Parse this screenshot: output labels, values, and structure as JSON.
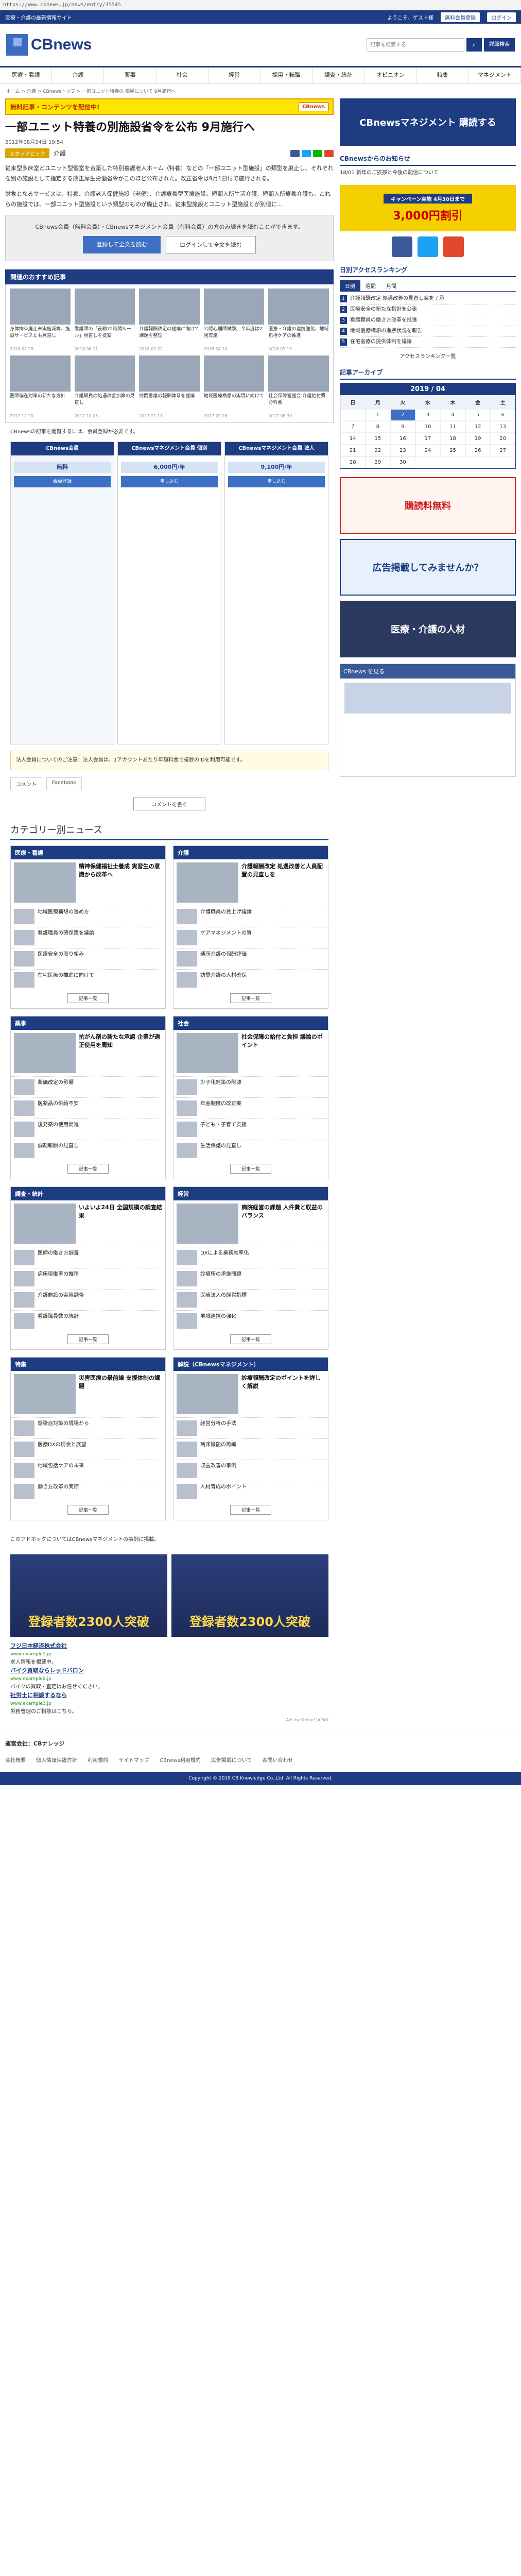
{
  "url": "https://www.cbnews.jp/news/entry/35545",
  "topbar": {
    "left": "医療・介護の最新情報サイト",
    "welcome": "ようこそ、ゲスト様",
    "member": "無料会員登録",
    "login": "ログイン"
  },
  "logo": "CBnews",
  "search": {
    "placeholder": "記事を検索する",
    "advanced": "詳細検索"
  },
  "nav": [
    "医療・看護",
    "介護",
    "薬事",
    "社会",
    "経営",
    "採用・転職",
    "調査・統計",
    "オピニオン",
    "特集",
    "マネジメント"
  ],
  "breadcrumb": "ホーム > 介護 > CBnewsトップ > 一部ユニット特養の 部屋について 9月施行へ",
  "banner": {
    "text": "無料記事・コンテンツを配信中!",
    "badge": "CBnews"
  },
  "article": {
    "title": "一部ユニット特養の別施設省令を公布 9月施行へ",
    "date": "2012年08月24日 19:54",
    "tag": "スタッフピック",
    "category": "介護",
    "body1": "従来型多床室とユニット型個室を合築した特別養護老人ホーム（特養）などの「一部ユニット型施設」の類型を廃止し、それぞれを別の施設として指定する改正厚生労働省令がこのほど公布された。改正省令は9月1日付で施行される。",
    "body2": "対象となるサービスは、特養、介護老人保健施設（老健）、介護療養型医療施設。短期入所生活介護、短期入所療養介護も。これらの施設では、一部ユニット型施設という類型のものが廃止され、従来型施設とユニット型施設とが別個に...",
    "cta_text": "CBnews会員（無料会員）・CBnewsマネジメント会員（有料会員）の方のみ続きを読むことができます。",
    "cta_login": "登録して全文を読む",
    "cta_more": "ログインして全文を読む"
  },
  "related": {
    "head": "関連のおすすめ記事",
    "items": [
      {
        "t": "身体拘束廃止未実施減算、施設サービスとも見直し",
        "d": "2018.07.28"
      },
      {
        "t": "看護師の「夜勤72時間ルール」見直しを提案",
        "d": "2018.06.11"
      },
      {
        "t": "介護報酬改定の議論に向けて課題を整理",
        "d": "2018.02.22"
      },
      {
        "t": "公認心理師試験、今年度は2回実施",
        "d": "2018.04.10"
      },
      {
        "t": "医療・介護の連携強化、地域包括ケアの推進",
        "d": "2018.03.15"
      },
      {
        "t": "医師偏在対策の新たな方針",
        "d": "2017.12.20"
      },
      {
        "t": "介護職員の処遇改善加算の見直し",
        "d": "2017.10.05"
      },
      {
        "t": "訪問看護の報酬体系を議論",
        "d": "2017.11.11"
      },
      {
        "t": "地域医療構想の実現に向けて",
        "d": "2017.09.18"
      },
      {
        "t": "社会保障審議会 介護給付費分科会",
        "d": "2017.08.30"
      }
    ]
  },
  "plans": {
    "note": "CBnewsの記事を閲覧するには、会員登録が必要です。",
    "items": [
      {
        "name": "CBnews会員",
        "price": "無料",
        "btn": "会員登録"
      },
      {
        "name": "CBnewsマネジメント会員 個別",
        "price": "6,000円/年",
        "btn": "申し込む"
      },
      {
        "name": "CBnewsマネジメント会員 法人",
        "price": "9,100円/年",
        "btn": "申し込む"
      }
    ]
  },
  "yellow_note": "法人会員についてのご注意：法人会員は、1アカウントあたり年額料金で複数のIDを利用可能です。",
  "comments": {
    "comment": "コメント",
    "facebook": "Facebook",
    "add": "コメントを書く"
  },
  "cat_title": "カテゴリー別ニュース",
  "categories": [
    {
      "name": "医療・看護",
      "top": "精神保健福祉士養成 実習生の意識から改革へ",
      "items": [
        "地域医療構想の進め方",
        "看護職員の確保策を議論",
        "医療安全の取り組み",
        "在宅医療の推進に向けて"
      ],
      "more": "記事一覧"
    },
    {
      "name": "介護",
      "top": "介護報酬改定 処遇改善と人員配置の見直しを",
      "items": [
        "介護職員の賃上げ議論",
        "ケアマネジメントの質",
        "通所介護の報酬評価",
        "訪問介護の人材確保"
      ],
      "more": "記事一覧"
    },
    {
      "name": "薬事",
      "top": "抗がん剤の新たな承認 企業が適正使用を周知",
      "items": [
        "薬価改定の影響",
        "医薬品の供給不安",
        "後発薬の使用促進",
        "調剤報酬の見直し"
      ],
      "more": "記事一覧"
    },
    {
      "name": "社会",
      "top": "社会保障の給付と負担 議論のポイント",
      "items": [
        "少子化対策の財源",
        "年金制度の改正案",
        "子ども・子育て支援",
        "生活保護の見直し"
      ],
      "more": "記事一覧"
    },
    {
      "name": "調査・統計",
      "top": "いよいよ24日 全国規模の調査結果",
      "items": [
        "医師の働き方調査",
        "病床稼働率の推移",
        "介護施設の実態調査",
        "看護職員数の統計"
      ],
      "more": "記事一覧"
    },
    {
      "name": "経営",
      "top": "病院経営の課題 人件費と収益のバランス",
      "items": [
        "DXによる業務効率化",
        "診療所の承継問題",
        "医療法人の経営指標",
        "地域連携の強化"
      ],
      "more": "記事一覧"
    },
    {
      "name": "特集",
      "top": "災害医療の最前線 支援体制の課題",
      "items": [
        "感染症対策の現場から",
        "医療DXの現状と展望",
        "地域包括ケアの未来",
        "働き方改革の実際"
      ],
      "more": "記事一覧"
    },
    {
      "name": "解説（CBnewsマネジメント）",
      "top": "診療報酬改定のポイントを詳しく解説",
      "items": [
        "経営分析の手法",
        "病床機能の再編",
        "収益改善の事例",
        "人材育成のポイント"
      ],
      "more": "記事一覧"
    }
  ],
  "ads": {
    "label": "このアドホックについてはCBnewsマネジメントの事例に掲載。",
    "big1": "登録者数2300人突破",
    "big2": "登録者数2300人突破",
    "t1": "フジ日本経済株式会社",
    "u1": "www.example1.jp",
    "d1": "求人情報を掲載中。",
    "t2": "バイク買取ならレッドバロン",
    "u2": "www.example2.jp",
    "d2": "バイクの買取・査定はお任せください。",
    "t3": "社労士に相談するなら",
    "u3": "www.example3.jp",
    "d3": "労務管理のご相談はこちら。",
    "adsby": "Ads by Yahoo! JAPAN"
  },
  "footer": {
    "company": "運営会社：CBナレッジ",
    "links": [
      "会社概要",
      "個人情報保護方針",
      "利用規約",
      "サイトマップ",
      "CBnews利用規約",
      "広告掲載について",
      "お問い合わせ"
    ],
    "copyright": "Copyright © 2019 CB Knowledge Co.,Ltd. All Rights Reserved."
  },
  "side": {
    "mgmt": "CBnewsマネジメント 購読する",
    "notice_head": "CBnewsからのお知らせ",
    "notice": "18/01 新年のご挨拶と今後の配信について",
    "campaign_cap": "キャンペーン実施 4月30日まで",
    "campaign_body": "3,000円割引",
    "ranking_head": "日別アクセスランキング",
    "tabs": [
      "日別",
      "週間",
      "月間"
    ],
    "ranks": [
      "介護報酬改定 処遇改善の見直し案を了承",
      "医療安全の新たな指針を公表",
      "看護職員の働き方改革を推進",
      "地域医療構想の進捗状況を報告",
      "在宅医療の提供体制を議論"
    ],
    "rank_more": "アクセスランキング一覧",
    "cal_head": "記事アーカイブ",
    "cal_title": "2019 / 04",
    "days": [
      "日",
      "月",
      "火",
      "水",
      "木",
      "金",
      "土"
    ],
    "campaign2": "購読料無料",
    "side_ad2": "広告掲載してみませんか？",
    "side_ad3": "医療・介護の人材",
    "fb_head": "CBnews を見る"
  }
}
